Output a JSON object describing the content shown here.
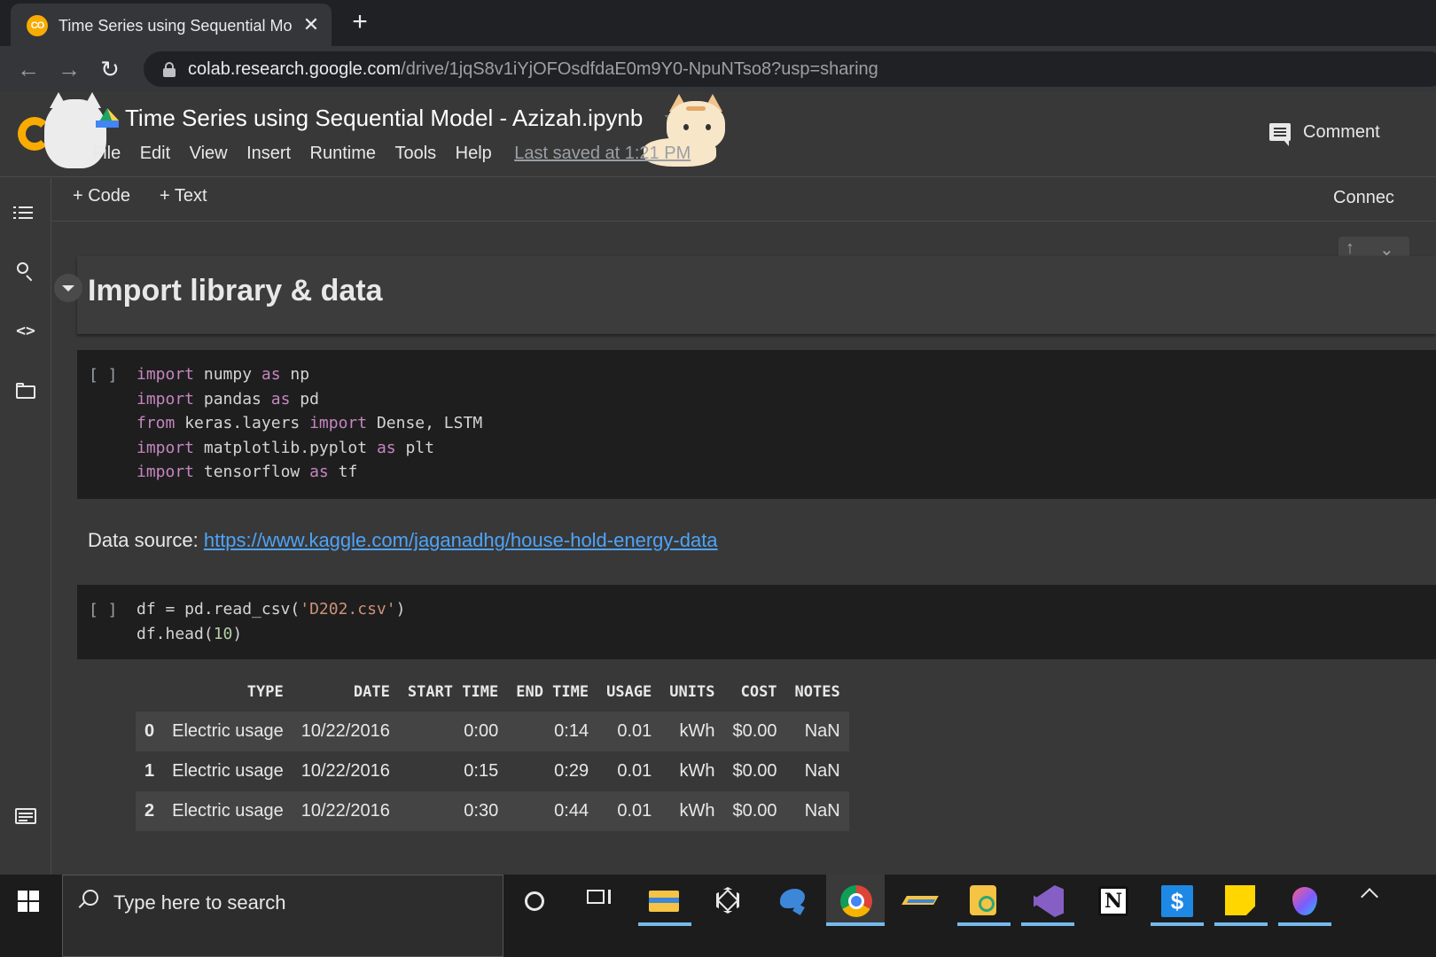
{
  "browser": {
    "tab_title": "Time Series using Sequential Mo",
    "tab_favicon": "CO",
    "url_host": "colab.research.google.com",
    "url_path": "/drive/1jqS8v1iYjOFOsdfdaE0m9Y0-NpuNTso8?usp=sharing"
  },
  "colab": {
    "title": "Time Series using Sequential Model - Azizah.ipynb",
    "menu": [
      "File",
      "Edit",
      "View",
      "Insert",
      "Runtime",
      "Tools",
      "Help"
    ],
    "last_saved": "Last saved at 1:21 PM",
    "comment_label": "Comment",
    "add_code": "+ Code",
    "add_text": "+ Text",
    "connect_label": "Connec"
  },
  "notebook": {
    "heading": "Import library & data",
    "run_bracket": "[ ]",
    "text_label": "Data source: ",
    "text_link": "https://www.kaggle.com/jaganadhg/house-hold-energy-data"
  },
  "dataframe": {
    "columns": [
      "",
      "TYPE",
      "DATE",
      "START TIME",
      "END TIME",
      "USAGE",
      "UNITS",
      "COST",
      "NOTES"
    ],
    "rows": [
      [
        "0",
        "Electric usage",
        "10/22/2016",
        "0:00",
        "0:14",
        "0.01",
        "kWh",
        "$0.00",
        "NaN"
      ],
      [
        "1",
        "Electric usage",
        "10/22/2016",
        "0:15",
        "0:29",
        "0.01",
        "kWh",
        "$0.00",
        "NaN"
      ],
      [
        "2",
        "Electric usage",
        "10/22/2016",
        "0:30",
        "0:44",
        "0.01",
        "kWh",
        "$0.00",
        "NaN"
      ]
    ]
  },
  "taskbar": {
    "search_placeholder": "Type here to search"
  },
  "colors": {
    "background": "#383838",
    "code_bg": "#1e1e1e",
    "keyword": "#c586c0",
    "string": "#ce9178",
    "link": "#4fa3f7"
  }
}
